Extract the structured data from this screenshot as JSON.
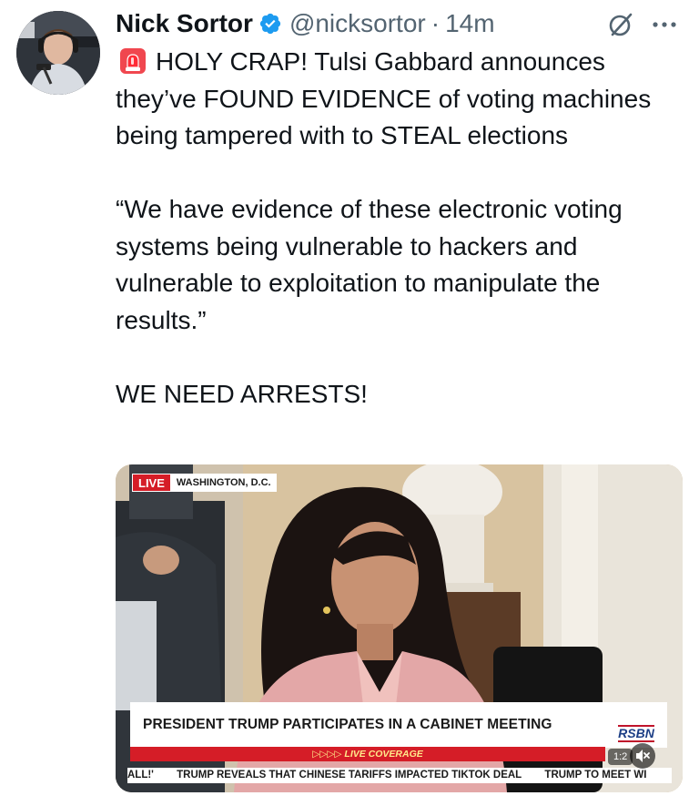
{
  "author": {
    "name": "Nick Sortor",
    "handle": "@nicksortor",
    "separator": "·",
    "time": "14m"
  },
  "tweet": {
    "line1": "HOLY CRAP! Tulsi Gabbard announces they’ve FOUND EVIDENCE of voting machines being tampered with to STEAL elections",
    "quote": "“We have evidence of these electronic voting systems being vulnerable to hackers and vulnerable to exploitation to manipulate the results.”",
    "closing": "WE NEED ARRESTS!"
  },
  "video": {
    "live_label": "LIVE",
    "location": "WASHINGTON, D.C.",
    "headline": "PRESIDENT TRUMP PARTICIPATES IN A CABINET MEETING",
    "live_coverage": "▷▷▷▷ LIVE COVERAGE",
    "network": "RSBN",
    "timestamp": "1:2",
    "ticker": [
      "ALL!'",
      "TRUMP REVEALS THAT CHINESE TARIFFS IMPACTED TIKTOK DEAL",
      "TRUMP TO MEET WI"
    ]
  },
  "icons": {
    "verified": "verified-badge-icon",
    "grok": "grok-icon",
    "more": "more-options-icon",
    "siren": "siren-emoji-icon",
    "mute": "muted-speaker-icon"
  },
  "colors": {
    "verified_blue": "#1d9bf0",
    "text": "#0f1419",
    "secondary_text": "#536471",
    "live_red": "#d51d27"
  }
}
